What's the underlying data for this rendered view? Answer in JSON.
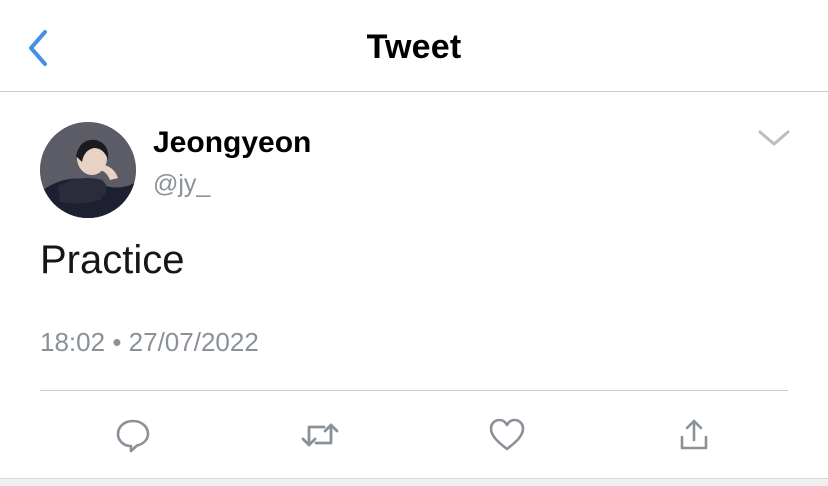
{
  "nav": {
    "title": "Tweet",
    "back_icon": "chevron-left-icon",
    "accent_color": "#4a90e2"
  },
  "tweet": {
    "author": {
      "display_name": "Jeongyeon",
      "handle": "@jy_"
    },
    "text": "Practice",
    "time": "18:02",
    "separator": "•",
    "date": "27/07/2022"
  },
  "actions": [
    {
      "name": "reply",
      "icon": "reply-bubble-icon"
    },
    {
      "name": "retweet",
      "icon": "retweet-icon"
    },
    {
      "name": "like",
      "icon": "heart-icon"
    },
    {
      "name": "share",
      "icon": "share-upload-icon"
    }
  ],
  "colors": {
    "secondary_text": "#8a9199",
    "icon_gray": "#8a9199",
    "divider": "#c9cdd1"
  }
}
